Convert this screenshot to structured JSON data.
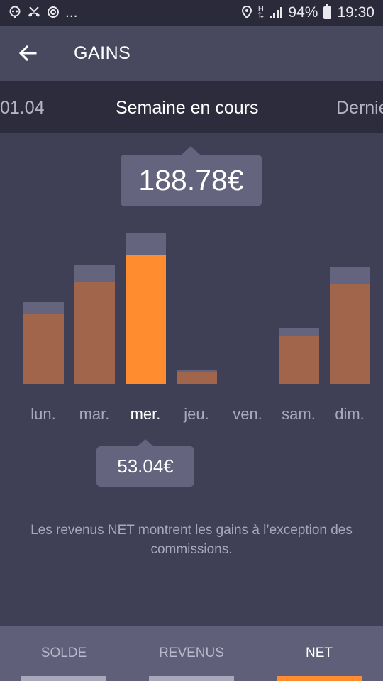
{
  "status_bar": {
    "left_icons": [
      "notification-icon",
      "missed-call-icon",
      "sync-icon"
    ],
    "more": "...",
    "battery": "94%",
    "time": "19:30",
    "right_icons": [
      "location-icon",
      "hplus-data-icon",
      "signal-icon",
      "battery-icon"
    ]
  },
  "app_bar": {
    "title": "GAINS",
    "back_icon": "arrow-left-icon"
  },
  "periods": {
    "previous": "01.04",
    "current": "Semaine en cours",
    "next": "Dernie"
  },
  "total": "188.78€",
  "chart_data": {
    "type": "bar",
    "categories": [
      "lun.",
      "mar.",
      "mer.",
      "jeu.",
      "ven.",
      "sam.",
      "dim."
    ],
    "series": [
      {
        "values": [
          35.0,
          51.0,
          64.8,
          6.0,
          0,
          24.0,
          50.0
        ]
      },
      {
        "values": [
          6.0,
          9.0,
          11.0,
          1.2,
          0,
          4.0,
          8.6
        ]
      }
    ],
    "selected_index": 2,
    "selected_value": "53.04€",
    "colors": {
      "net": "#a0654a",
      "net_selected": "#ff8c2e",
      "commission": "#64647e"
    }
  },
  "info_text": "Les revenus NET montrent les gains à l’exception des commissions.",
  "bottom_tabs": [
    {
      "label": "SOLDE",
      "active": false
    },
    {
      "label": "REVENUS",
      "active": false
    },
    {
      "label": "NET",
      "active": true
    }
  ]
}
